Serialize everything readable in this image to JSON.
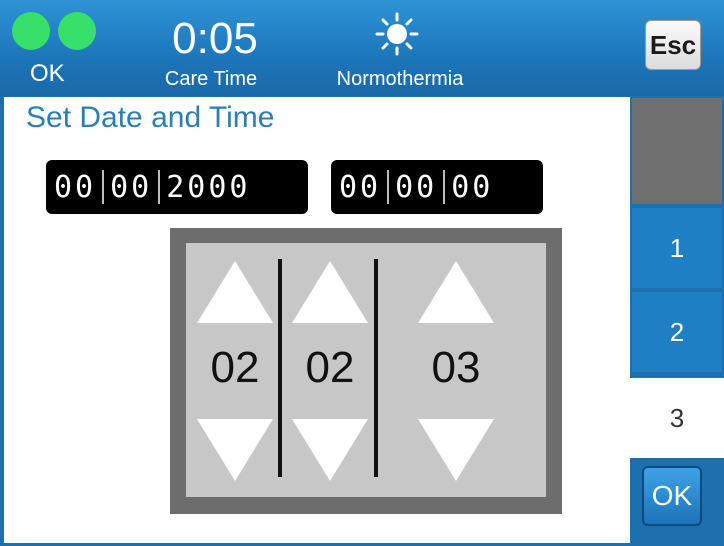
{
  "header": {
    "status_label": "OK",
    "care_time_value": "0:05",
    "care_time_label": "Care Time",
    "mode_icon": "sun-icon",
    "mode_label": "Normothermia",
    "esc_label": "Esc",
    "colors": {
      "status_led": "#36e06a",
      "header_bg": "#1d76ba"
    }
  },
  "page": {
    "title": "Set Date and Time"
  },
  "date_readout": {
    "day": "00",
    "month": "00",
    "year": "2000"
  },
  "time_readout": {
    "hour": "00",
    "minute": "00",
    "second": "00"
  },
  "spinner": {
    "columns": [
      {
        "value": "02"
      },
      {
        "value": "02"
      },
      {
        "value": "03"
      }
    ]
  },
  "tabs": [
    {
      "label": "1"
    },
    {
      "label": "2"
    },
    {
      "label": "3",
      "selected": true
    }
  ],
  "ok_label": "OK"
}
